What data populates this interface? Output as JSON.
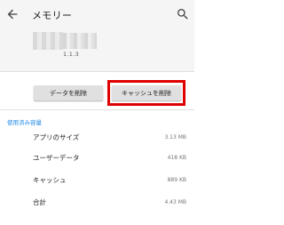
{
  "header": {
    "title": "メモリー",
    "back_icon": "arrow-back-icon",
    "search_icon": "search-icon"
  },
  "app": {
    "version": "1.1.3"
  },
  "actions": {
    "clear_data_label": "データを削除",
    "clear_cache_label": "キャッシュを削除"
  },
  "usage": {
    "section_title": "使用済み容量",
    "rows": [
      {
        "label": "アプリのサイズ",
        "value": "3.13 MB"
      },
      {
        "label": "ユーザーデータ",
        "value": "418 KB"
      },
      {
        "label": "キャッシュ",
        "value": "889 KB"
      },
      {
        "label": "合計",
        "value": "4.43 MB"
      }
    ]
  },
  "colors": {
    "accent": "#1e88e5",
    "highlight": "#e00000",
    "header_bg": "#f5f5f5"
  }
}
